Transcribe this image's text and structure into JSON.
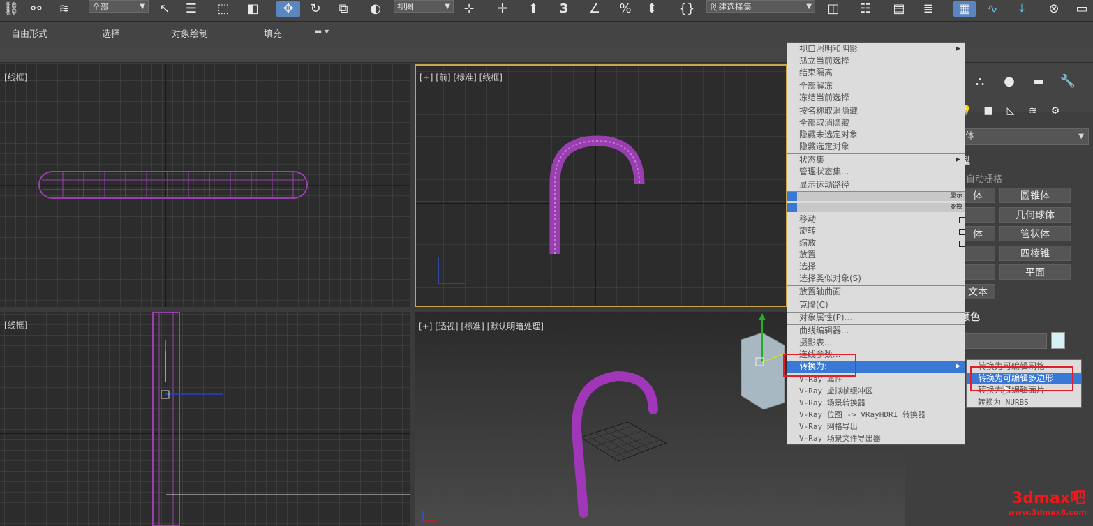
{
  "toolbar": {
    "filter_dropdown": "全部",
    "ref_coord_dropdown": "视图",
    "selection_set_dropdown": "创建选择集",
    "snap_value": "3"
  },
  "ribbon": {
    "tabs": [
      "自由形式",
      "选择",
      "对象绘制",
      "填充"
    ]
  },
  "viewports": {
    "top_left": "[线框]",
    "top_right": "[+] [前] [标准] [线框]",
    "bottom_left": "[线框]",
    "bottom_right": "[+] [透视] [标准] [默认明暗处理]"
  },
  "command_panel": {
    "dropdown_label": "体",
    "rollout_title": "型",
    "autogrid_label": "自动栅格",
    "buttons_right": [
      "圆锥体",
      "几何球体",
      "管状体",
      "四棱锥",
      "平面"
    ],
    "buttons_left": [
      "体",
      "",
      "体",
      "",
      "",
      "文本"
    ],
    "color_rollout": "颜色"
  },
  "context_menu": {
    "items": [
      {
        "label": "视口照明和阴影",
        "submenu": true
      },
      {
        "label": "孤立当前选择"
      },
      {
        "label": "结束隔离"
      },
      {
        "label": "全部解冻"
      },
      {
        "label": "冻结当前选择"
      },
      {
        "label": "按名称取消隐藏"
      },
      {
        "label": "全部取消隐藏"
      },
      {
        "label": "隐藏未选定对象"
      },
      {
        "label": "隐藏选定对象"
      },
      {
        "label": "状态集",
        "submenu": true
      },
      {
        "label": "管理状态集..."
      },
      {
        "label": "显示运动路径"
      },
      {
        "label": "显示"
      },
      {
        "label": "变换"
      },
      {
        "label": "移动"
      },
      {
        "label": "旋转"
      },
      {
        "label": "缩放"
      },
      {
        "label": "放置"
      },
      {
        "label": "选择"
      },
      {
        "label": "选择类似对象(S)"
      },
      {
        "label": "放置轴曲面"
      },
      {
        "label": "克隆(C)"
      },
      {
        "label": "对象属性(P)..."
      },
      {
        "label": "曲线编辑器..."
      },
      {
        "label": "摄影表..."
      },
      {
        "label": "连线参数..."
      },
      {
        "label": "转换为:",
        "submenu": true,
        "highlighted": true
      },
      {
        "label": "V-Ray 属性"
      },
      {
        "label": "V-Ray 虚拟帧缓冲区"
      },
      {
        "label": "V-Ray 场景转换器"
      },
      {
        "label": "V-Ray 位图 -> VRayHDRI 转换器"
      },
      {
        "label": "V-Ray 网格导出"
      },
      {
        "label": "V-Ray 场景文件导出器"
      }
    ]
  },
  "convert_submenu": {
    "items": [
      {
        "label": "转换为可编辑网格"
      },
      {
        "label": "转换为可编辑多边形",
        "highlighted": true
      },
      {
        "label": "转换为可编辑面片"
      },
      {
        "label": "转换为 NURBS"
      }
    ]
  },
  "watermark": {
    "brand": "3dmax吧",
    "url": "www.3dmax8.com"
  },
  "colors": {
    "highlight": "#3a78d6",
    "annotation_red": "#e2202a",
    "object_purple": "#9a3fb0",
    "viewport_active_border": "#c9a54a"
  }
}
